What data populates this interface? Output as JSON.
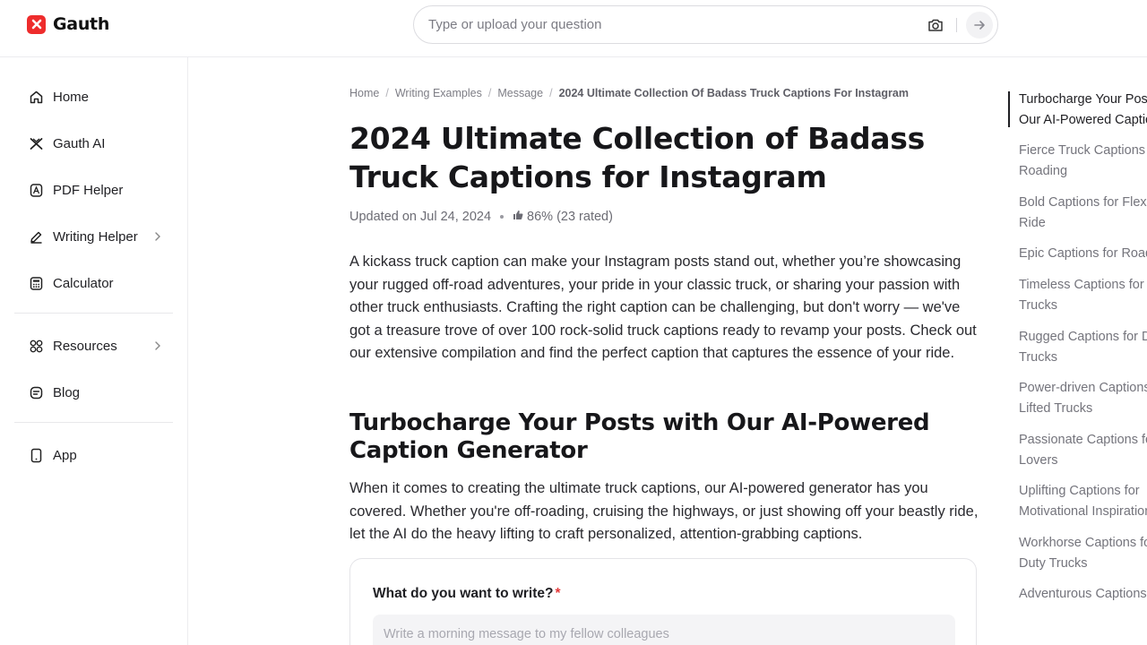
{
  "header": {
    "logo_text": "Gauth",
    "search_placeholder": "Type or upload your question"
  },
  "sidebar": {
    "items": [
      {
        "label": "Home",
        "icon": "home-icon"
      },
      {
        "label": "Gauth AI",
        "icon": "gauth-ai-icon"
      },
      {
        "label": "PDF Helper",
        "icon": "pdf-icon"
      },
      {
        "label": "Writing Helper",
        "icon": "pen-icon",
        "expandable": true
      },
      {
        "label": "Calculator",
        "icon": "calculator-icon"
      },
      {
        "label": "Resources",
        "icon": "grid-icon",
        "expandable": true
      },
      {
        "label": "Blog",
        "icon": "blog-icon"
      },
      {
        "label": "App",
        "icon": "phone-icon"
      }
    ]
  },
  "breadcrumb": {
    "items": [
      "Home",
      "Writing Examples",
      "Message"
    ],
    "current": "2024 Ultimate Collection Of Badass Truck Captions For Instagram"
  },
  "article": {
    "title": "2024 Ultimate Collection of Badass Truck Captions for Instagram",
    "updated": "Updated on Jul 24, 2024",
    "rating": "86% (23 rated)",
    "intro": "A kickass truck caption can make your Instagram posts stand out, whether you’re showcasing your rugged off-road adventures, your pride in your classic truck, or sharing your passion with other truck enthusiasts. Crafting the right caption can be challenging, but don't worry — we've got a treasure trove of over 100 rock-solid truck captions ready to revamp your posts. Check out our extensive compilation and find the perfect caption that captures the essence of your ride.",
    "section_title": "Turbocharge Your Posts with Our AI-Powered Caption Generator",
    "section_text": "When it comes to creating the ultimate truck captions, our AI-powered generator has you covered. Whether you're off-roading, cruising the highways, or just showing off your beastly ride, let the AI do the heavy lifting to craft personalized, attention-grabbing captions."
  },
  "generator": {
    "label": "What do you want to write?",
    "required_mark": "*",
    "input_placeholder": "Write a morning message to my fellow colleagues"
  },
  "toc": {
    "items": [
      "Turbocharge Your Posts with\nOur AI-Powered Caption Generator",
      "Fierce Truck Captions for Off-\nRoading",
      "Bold Captions for Flexing Your\nRide",
      "Epic Captions for Road Trips",
      "Timeless Captions for Classic\nTrucks",
      "Rugged Captions for Diesel\nTrucks",
      "Power-driven Captions for\nLifted Trucks",
      "Passionate Captions for Truck\nLovers",
      "Uplifting Captions for\nMotivational Inspiration",
      "Workhorse Captions for Heavy\nDuty Trucks",
      "Adventurous Captions for"
    ],
    "active_index": 0
  },
  "colors": {
    "brand": "#ee2c2c",
    "text": "#1f1f23",
    "muted": "#74747c"
  }
}
